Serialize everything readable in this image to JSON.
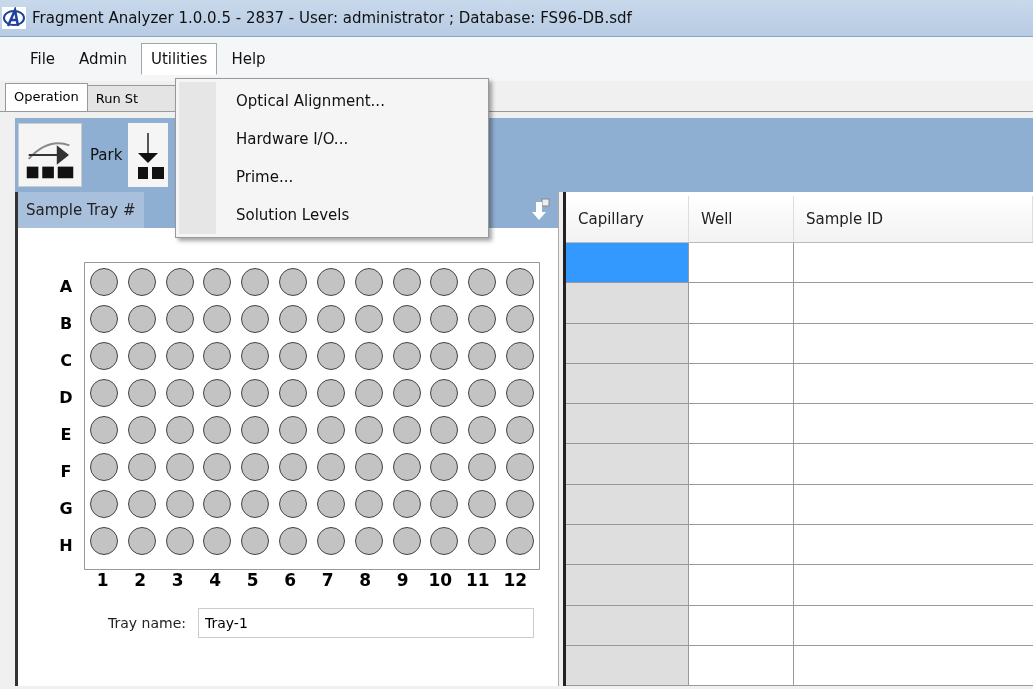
{
  "window": {
    "title": "Fragment Analyzer 1.0.0.5 - 2837 - User: administrator ; Database: FS96-DB.sdf"
  },
  "menu_bar": [
    {
      "label": "File",
      "selected": false
    },
    {
      "label": "Admin",
      "selected": false
    },
    {
      "label": "Utilities",
      "selected": true
    },
    {
      "label": "Help",
      "selected": false
    }
  ],
  "utilities_menu": [
    "Optical Alignment...",
    "Hardware I/O...",
    "Prime...",
    "Solution Levels"
  ],
  "tabs": [
    {
      "label": "Operation",
      "selected": true
    },
    {
      "label": "Run St",
      "selected": false
    }
  ],
  "toolbar": [
    {
      "label": "Park"
    }
  ],
  "sample_tray": {
    "title": "Sample Tray #",
    "rows": [
      "A",
      "B",
      "C",
      "D",
      "E",
      "F",
      "G",
      "H"
    ],
    "columns": [
      "1",
      "2",
      "3",
      "4",
      "5",
      "6",
      "7",
      "8",
      "9",
      "10",
      "11",
      "12"
    ],
    "tray_name_label": "Tray name:",
    "tray_name": "Tray-1"
  },
  "table": {
    "columns": [
      "Capillary",
      "Well",
      "Sample ID"
    ],
    "rows": [
      {
        "selected": true
      },
      {
        "selected": false
      },
      {
        "selected": false
      },
      {
        "selected": false
      },
      {
        "selected": false
      },
      {
        "selected": false
      },
      {
        "selected": false
      },
      {
        "selected": false
      },
      {
        "selected": false
      },
      {
        "selected": false
      },
      {
        "selected": false
      }
    ]
  }
}
